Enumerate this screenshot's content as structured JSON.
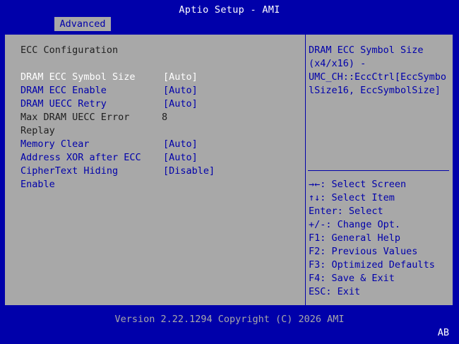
{
  "header": {
    "title": "Aptio Setup - AMI",
    "tab": "Advanced"
  },
  "section_title": "ECC Configuration",
  "settings": [
    {
      "label": "DRAM ECC Symbol Size",
      "value": "[Auto]"
    },
    {
      "label": "DRAM ECC Enable",
      "value": "[Auto]"
    },
    {
      "label": "DRAM UECC Retry",
      "value": "[Auto]"
    },
    {
      "label": "Max DRAM UECC Error",
      "label2": "Replay",
      "value": "8"
    },
    {
      "label": "Memory Clear",
      "value": "[Auto]"
    },
    {
      "label": "Address XOR after ECC",
      "value": "[Auto]"
    },
    {
      "label": "CipherText Hiding",
      "label2": "Enable",
      "value": "[Disable]"
    }
  ],
  "help": {
    "lines": [
      "DRAM ECC Symbol Size",
      "(x4/x16) -",
      "UMC_CH::EccCtrl[EccSymbo",
      "lSize16, EccSymbolSize]"
    ]
  },
  "keys": [
    {
      "key": "→←",
      "desc": ": Select Screen"
    },
    {
      "key": "↑↓",
      "desc": ": Select Item"
    },
    {
      "key": "Enter",
      "desc": ": Select"
    },
    {
      "key": "+/-",
      "desc": ": Change Opt."
    },
    {
      "key": "F1",
      "desc": ": General Help"
    },
    {
      "key": "F2",
      "desc": ": Previous Values"
    },
    {
      "key": "F3",
      "desc": ": Optimized Defaults"
    },
    {
      "key": "F4",
      "desc": ": Save & Exit"
    },
    {
      "key": "ESC",
      "desc": ": Exit"
    }
  ],
  "footer": {
    "version": "Version 2.22.1294 Copyright (C) 2026 AMI",
    "badge": "AB"
  }
}
